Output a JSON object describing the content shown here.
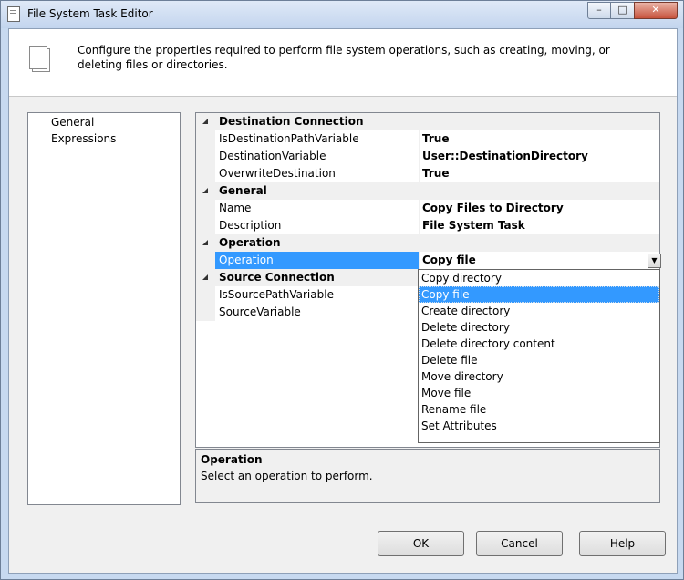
{
  "window": {
    "title": "File System Task Editor",
    "minimize": "–",
    "maximize": "□",
    "close": "✕"
  },
  "header": {
    "description": "Configure the properties required to perform file system operations, such as creating, moving, or deleting files or directories."
  },
  "nav": {
    "items": [
      "General",
      "Expressions"
    ],
    "selected": "General"
  },
  "properties": {
    "destination_connection": "Destination Connection",
    "is_destination_path_variable": {
      "label": "IsDestinationPathVariable",
      "value": "True"
    },
    "destination_variable": {
      "label": "DestinationVariable",
      "value": "User::DestinationDirectory"
    },
    "overwrite_destination": {
      "label": "OverwriteDestination",
      "value": "True"
    },
    "general": "General",
    "name": {
      "label": "Name",
      "value": "Copy Files to Directory"
    },
    "description": {
      "label": "Description",
      "value": "File System Task"
    },
    "operation_cat": "Operation",
    "operation": {
      "label": "Operation",
      "value": "Copy file"
    },
    "source_connection": "Source Connection",
    "is_source_path_variable": {
      "label": "IsSourcePathVariable"
    },
    "source_variable": {
      "label": "SourceVariable"
    }
  },
  "dropdown": {
    "options": [
      "Copy directory",
      "Copy file",
      "Create directory",
      "Delete directory",
      "Delete directory content",
      "Delete file",
      "Move directory",
      "Move file",
      "Rename file",
      "Set Attributes"
    ],
    "selected": "Copy file"
  },
  "help_panel": {
    "title": "Operation",
    "description": "Select an operation to perform."
  },
  "buttons": {
    "ok": "OK",
    "cancel": "Cancel",
    "help": "Help"
  },
  "icons": {
    "app": "document-icon",
    "header": "pages-icon",
    "dropdown_arrow": "chevron-down-icon"
  },
  "colors": {
    "selection": "#3399ff",
    "title_bar": "#c7d9f0"
  }
}
